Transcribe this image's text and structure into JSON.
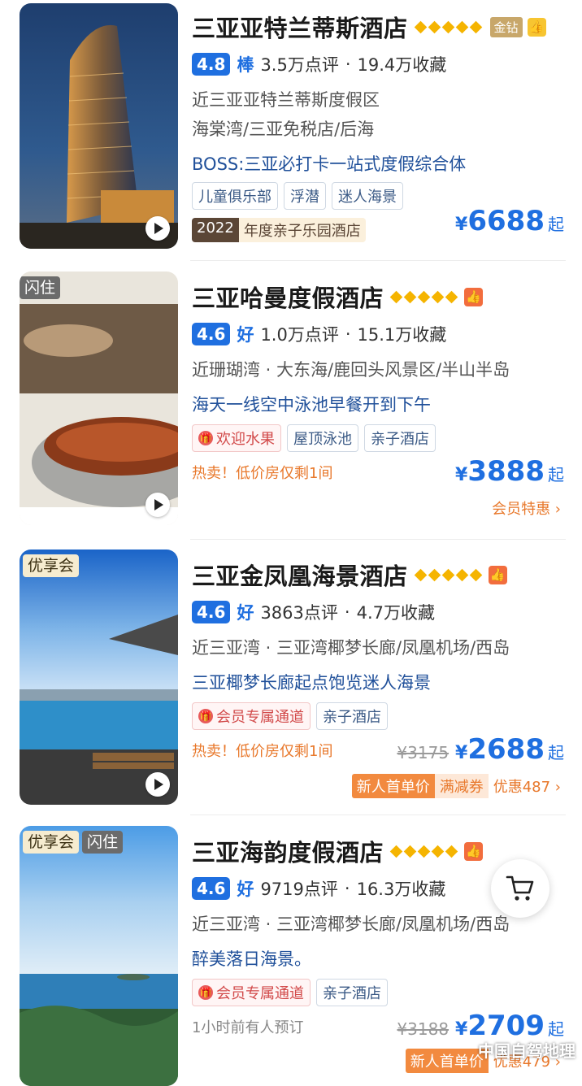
{
  "hotels": [
    {
      "name": "三亚亚特兰蒂斯酒店",
      "stars": 5,
      "badge_gold": "金钻",
      "score": "4.8",
      "grade": "棒",
      "reviews": "3.5万点评",
      "favorites": "19.4万收藏",
      "location_lines": [
        "近三亚亚特兰蒂斯度假区",
        "海棠湾/三亚免税店/后海"
      ],
      "slogan": "BOSS:三亚必打卡一站式度假综合体",
      "tags": [
        "儿童俱乐部",
        "浮潜",
        "迷人海景"
      ],
      "award_year": "2022",
      "award_name": "年度亲子乐园酒店",
      "price": "6688",
      "price_suffix": "起"
    },
    {
      "name": "三亚哈曼度假酒店",
      "stars": 5,
      "image_badges": [
        "闪住"
      ],
      "score": "4.6",
      "grade": "好",
      "reviews": "1.0万点评",
      "favorites": "15.1万收藏",
      "location": "近珊瑚湾 · 大东海/鹿回头风景区/半山半岛",
      "slogan": "海天一线空中泳池早餐开到下午",
      "gift_tag": "欢迎水果",
      "tags": [
        "屋顶泳池",
        "亲子酒店"
      ],
      "hot": "热卖！低价房仅剩1间",
      "price": "3888",
      "price_suffix": "起",
      "member": "会员特惠 ›"
    },
    {
      "name": "三亚金凤凰海景酒店",
      "stars": 5,
      "image_badges": [
        "优享会"
      ],
      "score": "4.6",
      "grade": "好",
      "reviews": "3863点评",
      "favorites": "4.7万收藏",
      "location": "近三亚湾 · 三亚湾椰梦长廊/凤凰机场/西岛",
      "slogan": "三亚椰梦长廊起点饱览迷人海景",
      "gift_tag": "会员专属通道",
      "tags": [
        "亲子酒店"
      ],
      "hot": "热卖！低价房仅剩1间",
      "old_price": "¥3175",
      "price": "2688",
      "price_suffix": "起",
      "promo_new": "新人首单价",
      "promo_off": "满减券",
      "promo_disc": "优惠487 ›"
    },
    {
      "name": "三亚海韵度假酒店",
      "stars": 5,
      "image_badges": [
        "优享会",
        "闪住"
      ],
      "score": "4.6",
      "grade": "好",
      "reviews": "9719点评",
      "favorites": "16.3万收藏",
      "location": "近三亚湾 · 三亚湾椰梦长廊/凤凰机场/西岛",
      "slogan": "醉美落日海景。",
      "gift_tag": "会员专属通道",
      "tags": [
        "亲子酒店"
      ],
      "booked": "1小时前有人预订",
      "old_price": "¥3188",
      "price": "2709",
      "price_suffix": "起",
      "promo_new": "新人首单价",
      "promo_disc": "优惠479 ›"
    }
  ],
  "currency": "¥",
  "watermark": "中国自驾地理",
  "colors": {
    "accent": "#1f6fe0",
    "orange": "#e8782b",
    "star": "#f5b400"
  }
}
